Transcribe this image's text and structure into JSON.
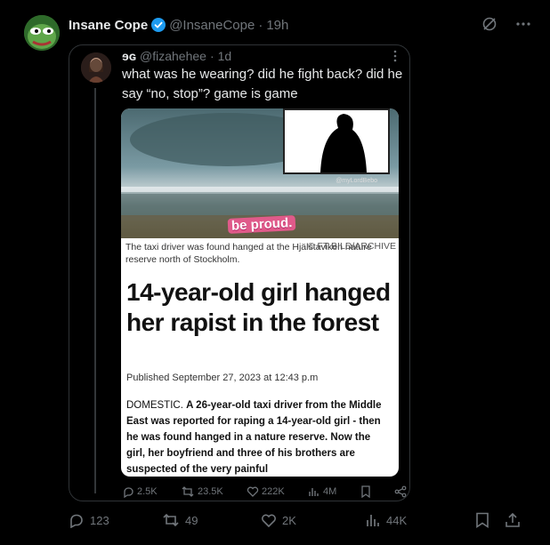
{
  "author": {
    "name": "Insane Cope",
    "handle": "@InsaneCope",
    "separator": "·",
    "time": "19h"
  },
  "quoted": {
    "name": "ɘɢ",
    "handle": "@fizahehee",
    "separator": "·",
    "time": "1d",
    "text": "what was he wearing? did he fight back? did he say “no, stop”? game is game",
    "media": {
      "watermark": "@myLordBebo",
      "sticker": "be proud.",
      "caption": "The taxi driver was found hanged at the Hjälstaviken nature reserve north of Stockholm.",
      "credit": "© FT BILD/ARCHIVE",
      "headline": "14-year-old girl hanged her rapist in the forest",
      "published": "Published September 27, 2023 at 12:43 p.m",
      "body_lead": "DOMESTIC.",
      "body_bold": "A 26-year-old taxi driver from the Middle East was reported for raping a 14-year-old girl - then he was found hanged in a nature reserve. Now the girl, her boyfriend and three of his brothers are suspected of the very painful"
    },
    "stats": {
      "replies": "2.5K",
      "reposts": "23.5K",
      "likes": "222K",
      "views": "4M"
    }
  },
  "stats": {
    "replies": "123",
    "reposts": "49",
    "likes": "2K",
    "views": "44K"
  },
  "colors": {
    "background": "#000000",
    "muted": "#71767b",
    "text": "#e7e9ea",
    "verified": "#1d9bf0",
    "border": "#2f3336"
  }
}
